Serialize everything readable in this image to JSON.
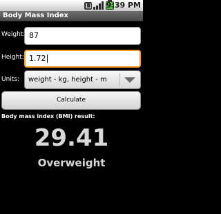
{
  "status_bar": {
    "time": "9:39 PM",
    "icons": [
      "usb-icon",
      "signal-icon",
      "battery-icon"
    ]
  },
  "app": {
    "title": "Body Mass Index"
  },
  "form": {
    "weight_label": "Weight:",
    "weight_value": "87",
    "height_label": "Height:",
    "height_value": "1.72",
    "units_label": "Units:",
    "units_selected": "weight - kg, height - m",
    "calculate_label": "Calculate"
  },
  "result": {
    "label": "Body mass index (BMI) result:",
    "value": "29.41",
    "category": "Overweight"
  },
  "colors": {
    "focus_border": "#f89a1e",
    "background": "#000000",
    "result_text": "#d8d8d8"
  }
}
